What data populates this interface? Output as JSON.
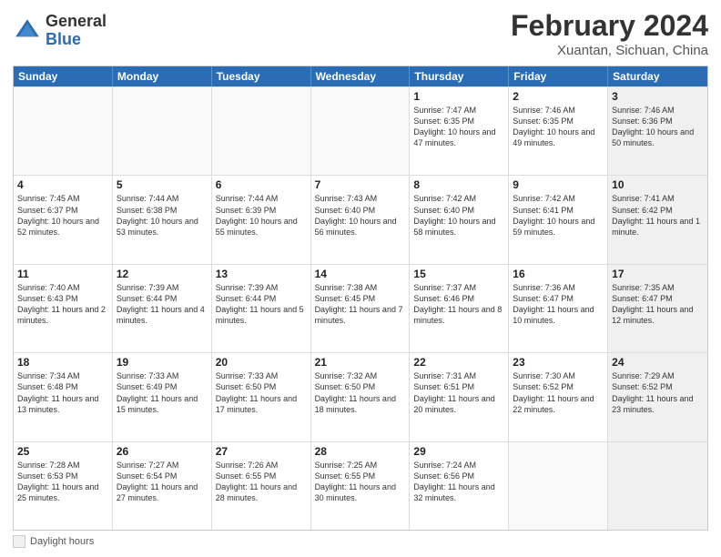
{
  "header": {
    "logo_general": "General",
    "logo_blue": "Blue",
    "title": "February 2024",
    "location": "Xuantan, Sichuan, China"
  },
  "calendar": {
    "days_of_week": [
      "Sunday",
      "Monday",
      "Tuesday",
      "Wednesday",
      "Thursday",
      "Friday",
      "Saturday"
    ],
    "rows": [
      [
        {
          "day": "",
          "info": "",
          "empty": true
        },
        {
          "day": "",
          "info": "",
          "empty": true
        },
        {
          "day": "",
          "info": "",
          "empty": true
        },
        {
          "day": "",
          "info": "",
          "empty": true
        },
        {
          "day": "1",
          "info": "Sunrise: 7:47 AM\nSunset: 6:35 PM\nDaylight: 10 hours and 47 minutes.",
          "empty": false
        },
        {
          "day": "2",
          "info": "Sunrise: 7:46 AM\nSunset: 6:35 PM\nDaylight: 10 hours and 49 minutes.",
          "empty": false
        },
        {
          "day": "3",
          "info": "Sunrise: 7:46 AM\nSunset: 6:36 PM\nDaylight: 10 hours and 50 minutes.",
          "empty": false,
          "shaded": true
        }
      ],
      [
        {
          "day": "4",
          "info": "Sunrise: 7:45 AM\nSunset: 6:37 PM\nDaylight: 10 hours and 52 minutes.",
          "empty": false
        },
        {
          "day": "5",
          "info": "Sunrise: 7:44 AM\nSunset: 6:38 PM\nDaylight: 10 hours and 53 minutes.",
          "empty": false
        },
        {
          "day": "6",
          "info": "Sunrise: 7:44 AM\nSunset: 6:39 PM\nDaylight: 10 hours and 55 minutes.",
          "empty": false
        },
        {
          "day": "7",
          "info": "Sunrise: 7:43 AM\nSunset: 6:40 PM\nDaylight: 10 hours and 56 minutes.",
          "empty": false
        },
        {
          "day": "8",
          "info": "Sunrise: 7:42 AM\nSunset: 6:40 PM\nDaylight: 10 hours and 58 minutes.",
          "empty": false
        },
        {
          "day": "9",
          "info": "Sunrise: 7:42 AM\nSunset: 6:41 PM\nDaylight: 10 hours and 59 minutes.",
          "empty": false
        },
        {
          "day": "10",
          "info": "Sunrise: 7:41 AM\nSunset: 6:42 PM\nDaylight: 11 hours and 1 minute.",
          "empty": false,
          "shaded": true
        }
      ],
      [
        {
          "day": "11",
          "info": "Sunrise: 7:40 AM\nSunset: 6:43 PM\nDaylight: 11 hours and 2 minutes.",
          "empty": false
        },
        {
          "day": "12",
          "info": "Sunrise: 7:39 AM\nSunset: 6:44 PM\nDaylight: 11 hours and 4 minutes.",
          "empty": false
        },
        {
          "day": "13",
          "info": "Sunrise: 7:39 AM\nSunset: 6:44 PM\nDaylight: 11 hours and 5 minutes.",
          "empty": false
        },
        {
          "day": "14",
          "info": "Sunrise: 7:38 AM\nSunset: 6:45 PM\nDaylight: 11 hours and 7 minutes.",
          "empty": false
        },
        {
          "day": "15",
          "info": "Sunrise: 7:37 AM\nSunset: 6:46 PM\nDaylight: 11 hours and 8 minutes.",
          "empty": false
        },
        {
          "day": "16",
          "info": "Sunrise: 7:36 AM\nSunset: 6:47 PM\nDaylight: 11 hours and 10 minutes.",
          "empty": false
        },
        {
          "day": "17",
          "info": "Sunrise: 7:35 AM\nSunset: 6:47 PM\nDaylight: 11 hours and 12 minutes.",
          "empty": false,
          "shaded": true
        }
      ],
      [
        {
          "day": "18",
          "info": "Sunrise: 7:34 AM\nSunset: 6:48 PM\nDaylight: 11 hours and 13 minutes.",
          "empty": false
        },
        {
          "day": "19",
          "info": "Sunrise: 7:33 AM\nSunset: 6:49 PM\nDaylight: 11 hours and 15 minutes.",
          "empty": false
        },
        {
          "day": "20",
          "info": "Sunrise: 7:33 AM\nSunset: 6:50 PM\nDaylight: 11 hours and 17 minutes.",
          "empty": false
        },
        {
          "day": "21",
          "info": "Sunrise: 7:32 AM\nSunset: 6:50 PM\nDaylight: 11 hours and 18 minutes.",
          "empty": false
        },
        {
          "day": "22",
          "info": "Sunrise: 7:31 AM\nSunset: 6:51 PM\nDaylight: 11 hours and 20 minutes.",
          "empty": false
        },
        {
          "day": "23",
          "info": "Sunrise: 7:30 AM\nSunset: 6:52 PM\nDaylight: 11 hours and 22 minutes.",
          "empty": false
        },
        {
          "day": "24",
          "info": "Sunrise: 7:29 AM\nSunset: 6:52 PM\nDaylight: 11 hours and 23 minutes.",
          "empty": false,
          "shaded": true
        }
      ],
      [
        {
          "day": "25",
          "info": "Sunrise: 7:28 AM\nSunset: 6:53 PM\nDaylight: 11 hours and 25 minutes.",
          "empty": false
        },
        {
          "day": "26",
          "info": "Sunrise: 7:27 AM\nSunset: 6:54 PM\nDaylight: 11 hours and 27 minutes.",
          "empty": false
        },
        {
          "day": "27",
          "info": "Sunrise: 7:26 AM\nSunset: 6:55 PM\nDaylight: 11 hours and 28 minutes.",
          "empty": false
        },
        {
          "day": "28",
          "info": "Sunrise: 7:25 AM\nSunset: 6:55 PM\nDaylight: 11 hours and 30 minutes.",
          "empty": false
        },
        {
          "day": "29",
          "info": "Sunrise: 7:24 AM\nSunset: 6:56 PM\nDaylight: 11 hours and 32 minutes.",
          "empty": false
        },
        {
          "day": "",
          "info": "",
          "empty": true
        },
        {
          "day": "",
          "info": "",
          "empty": true,
          "shaded": true
        }
      ]
    ]
  },
  "footer": {
    "legend_label": "Daylight hours"
  }
}
